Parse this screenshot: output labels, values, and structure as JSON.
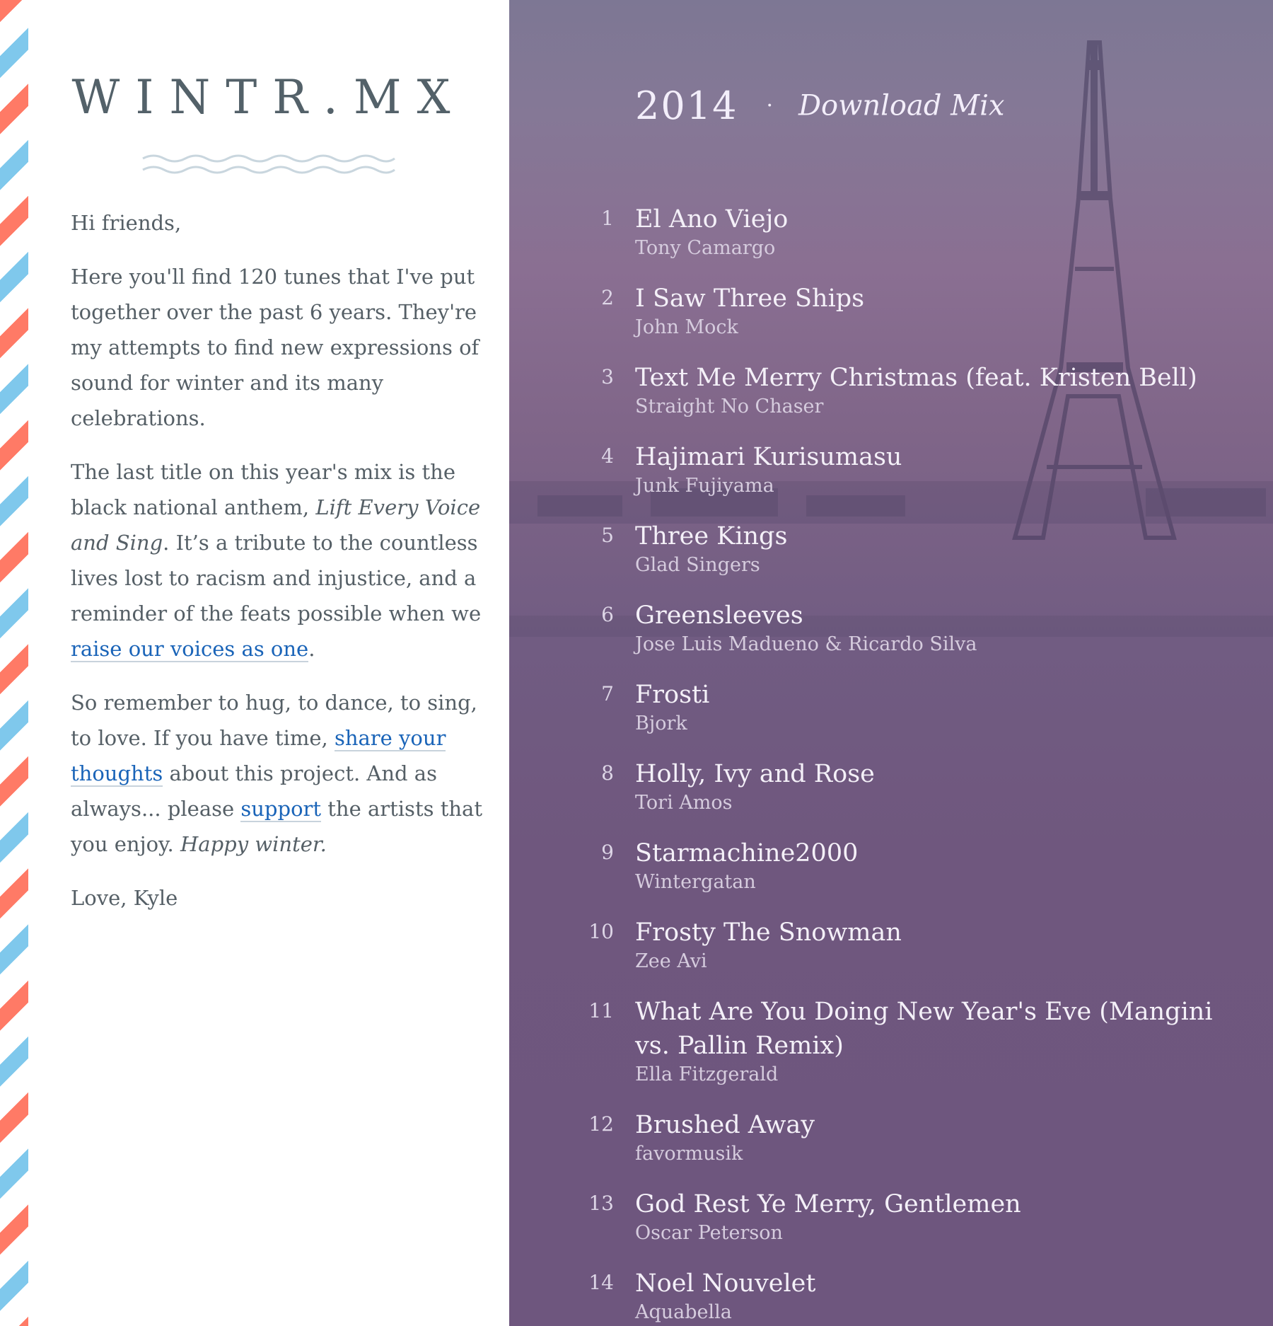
{
  "site": {
    "logo": "WINTR.MX"
  },
  "letter": {
    "greeting": "Hi friends,",
    "p1": "Here you'll find 120 tunes that I've put together over the past 6 years. They're my attempts to find new expressions of sound for winter and its many celebrations.",
    "p2_a": "The last title on this year's mix is the black national anthem, ",
    "p2_em": "Lift Every Voice and Sing",
    "p2_b": ". It’s a tribute to the countless lives lost to racism and injustice, and a reminder of the feats possible when we ",
    "p2_link": "raise our voices as one",
    "p2_c": ".",
    "p3_a": "So remember to hug, to dance, to sing, to love. If you have time, ",
    "p3_link1": "share your thoughts",
    "p3_b": " about this project. And as always... please ",
    "p3_link2": "support",
    "p3_c": " the artists that you enjoy. ",
    "p3_em": "Happy winter.",
    "signoff": "Love, Kyle"
  },
  "mix": {
    "year": "2014",
    "separator": "·",
    "download_label": "Download Mix",
    "tracks": [
      {
        "num": "1",
        "title": "El Ano Viejo",
        "artist": "Tony Camargo"
      },
      {
        "num": "2",
        "title": "I Saw Three Ships",
        "artist": "John Mock"
      },
      {
        "num": "3",
        "title": "Text Me Merry Christmas (feat. Kristen Bell)",
        "artist": "Straight No Chaser"
      },
      {
        "num": "4",
        "title": "Hajimari Kurisumasu",
        "artist": "Junk Fujiyama"
      },
      {
        "num": "5",
        "title": "Three Kings",
        "artist": "Glad Singers"
      },
      {
        "num": "6",
        "title": "Greensleeves",
        "artist": "Jose Luis Madueno & Ricardo Silva"
      },
      {
        "num": "7",
        "title": "Frosti",
        "artist": "Bjork"
      },
      {
        "num": "8",
        "title": "Holly, Ivy and Rose",
        "artist": "Tori Amos"
      },
      {
        "num": "9",
        "title": "Starmachine2000",
        "artist": "Wintergatan"
      },
      {
        "num": "10",
        "title": "Frosty The Snowman",
        "artist": "Zee Avi"
      },
      {
        "num": "11",
        "title": "What Are You Doing New Year's Eve (Mangini vs. Pallin Remix)",
        "artist": "Ella Fitzgerald"
      },
      {
        "num": "12",
        "title": "Brushed Away",
        "artist": "favormusik"
      },
      {
        "num": "13",
        "title": "God Rest Ye Merry, Gentlemen",
        "artist": "Oscar Peterson"
      },
      {
        "num": "14",
        "title": "Noel Nouvelet",
        "artist": "Aquabella"
      }
    ]
  },
  "colors": {
    "stripe_red": "#ff7a66",
    "stripe_blue": "#7fc8ec",
    "link": "#1a64b8",
    "panel_purple": "#6e567e"
  }
}
